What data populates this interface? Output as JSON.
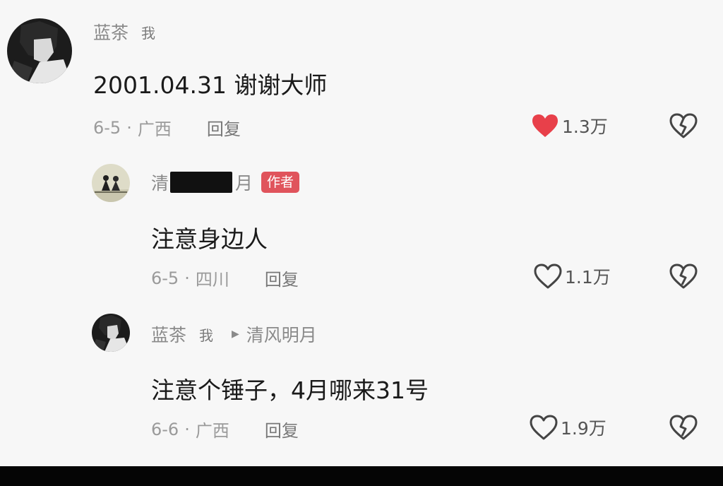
{
  "comments": [
    {
      "username": "蓝茶",
      "me_tag": "我",
      "content": "2001.04.31 谢谢大师",
      "date": "6-5",
      "location": "广西",
      "reply_label": "回复",
      "like_count": "1.3万",
      "liked": true
    },
    {
      "username_prefix": "清",
      "username_suffix": "月",
      "badge": "作者",
      "content": "注意身边人",
      "date": "6-5",
      "location": "四川",
      "reply_label": "回复",
      "like_count": "1.1万",
      "liked": false
    },
    {
      "username": "蓝茶",
      "me_tag": "我",
      "reply_to": "清风明月",
      "content": "注意个锤子，4月哪来31号",
      "date": "6-6",
      "location": "广西",
      "reply_label": "回复",
      "like_count": "1.9万",
      "liked": false
    }
  ],
  "separator": "·",
  "colors": {
    "liked_heart": "#e8404a",
    "author_badge": "#e0545c",
    "text_primary": "#1a1a1a",
    "text_secondary": "#8a8a8a"
  },
  "icons": {
    "like": "heart-icon",
    "dislike": "broken-heart-icon",
    "reply_arrow": "play-triangle-icon"
  }
}
